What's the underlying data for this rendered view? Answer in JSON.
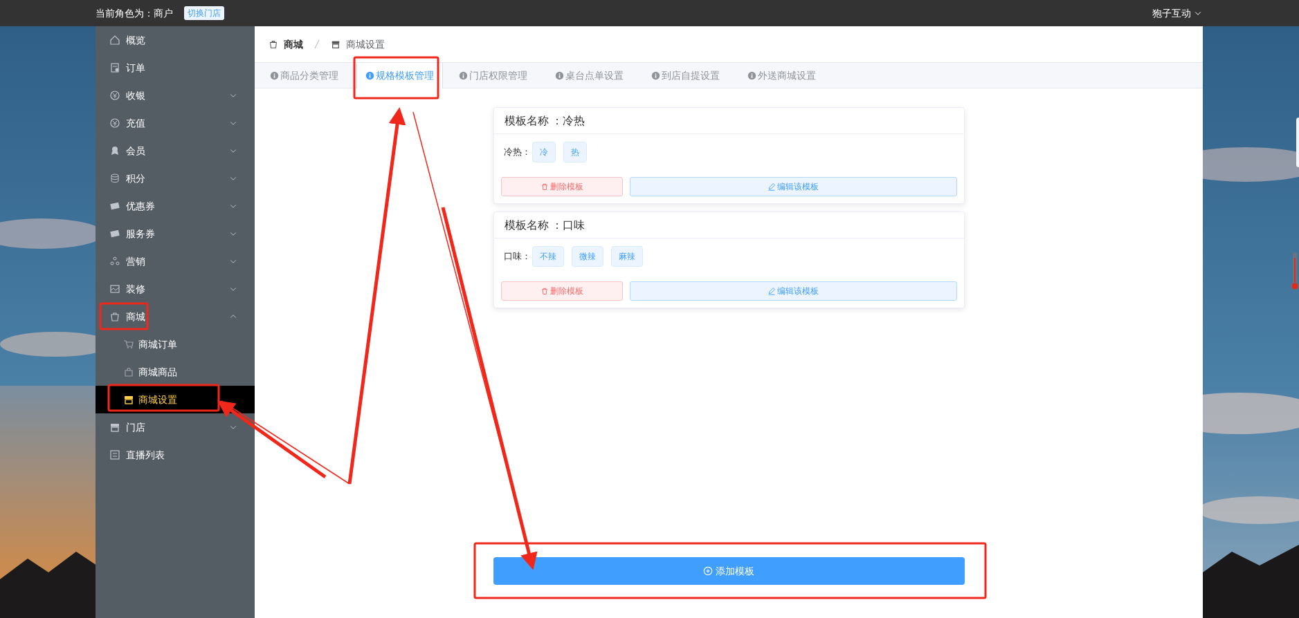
{
  "top_bar": {
    "role_text": "当前角色为：商户",
    "switch_button": "切换门店",
    "user_menu": "狍子互动"
  },
  "sidebar": {
    "items": [
      {
        "label": "概览",
        "selected": false
      },
      {
        "label": "订单",
        "selected": false
      },
      {
        "label": "收银",
        "selected": false,
        "expanded": false
      },
      {
        "label": "充值",
        "selected": false,
        "expanded": false
      },
      {
        "label": "会员",
        "selected": false,
        "expanded": false
      },
      {
        "label": "积分",
        "selected": false,
        "expanded": false
      },
      {
        "label": "优惠券",
        "selected": false,
        "expanded": false
      },
      {
        "label": "服务券",
        "selected": false,
        "expanded": false
      },
      {
        "label": "营销",
        "selected": false,
        "expanded": false
      },
      {
        "label": "装修",
        "selected": false,
        "expanded": false
      },
      {
        "label": "商城",
        "selected": false,
        "expanded": true,
        "children": [
          {
            "label": "商城订单",
            "selected": false
          },
          {
            "label": "商城商品",
            "selected": false
          },
          {
            "label": "商城设置",
            "selected": true
          }
        ]
      },
      {
        "label": "门店",
        "selected": false,
        "expanded": false
      },
      {
        "label": "直播列表",
        "selected": false
      }
    ]
  },
  "breadcrumb": [
    "商城",
    "商城设置"
  ],
  "tabs": [
    {
      "label": "商品分类管理",
      "selected": false
    },
    {
      "label": "规格模板管理",
      "selected": true
    },
    {
      "label": "门店权限管理",
      "selected": false
    },
    {
      "label": "桌台点单设置",
      "selected": false
    },
    {
      "label": "到店自提设置",
      "selected": false
    },
    {
      "label": "外送商城设置",
      "selected": false
    }
  ],
  "templates": [
    {
      "title": "模板名称 ：冷热",
      "spec_label": "冷热：",
      "values": [
        "冷",
        "热"
      ],
      "delete_button": "删除模板",
      "edit_button": "编辑该模板"
    },
    {
      "title": "模板名称 ：口味",
      "spec_label": "口味：",
      "values": [
        "不辣",
        "微辣",
        "麻辣"
      ],
      "delete_button": "删除模板",
      "edit_button": "编辑该模板"
    }
  ],
  "add_button": "添加模板"
}
